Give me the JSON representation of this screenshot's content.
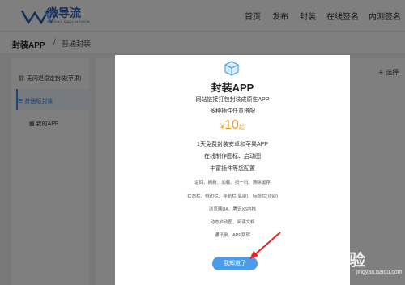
{
  "header": {
    "logo_text": "微导流",
    "logo_sub": "WEIDAO DAOLIUSHOW",
    "nav": [
      "首页",
      "发布",
      "封装",
      "在线签名",
      "内测签名"
    ]
  },
  "breadcrumb": {
    "title": "封装APP",
    "sep": "/",
    "current": "普通封装"
  },
  "sidebar": {
    "items": [
      {
        "label": "无闪退稳定封装(苹果)"
      },
      {
        "label": "普通版封装"
      },
      {
        "label": "我的APP"
      }
    ]
  },
  "main": {
    "select_label": "选择"
  },
  "modal": {
    "icon": "cube-icon",
    "title": "封装APP",
    "line1": "网站链接打包封装成原生APP",
    "line2": "多种插件任意搭配",
    "price_symbol": "¥",
    "price_value": "10",
    "price_suffix": "起",
    "line3": "1天免费封装安卓和苹果APP",
    "line4": "在线制作图标、启动图",
    "line5": "丰富插件等您配置",
    "features": [
      "返回、刷新、加载、扫一扫、清除缓存",
      "状态栏、侧边栏、导航栏(底部)、标题栏(顶部)",
      "浏览器UA、腾讯X5内核",
      "动态启动图、阅读文档",
      "通讯录、APP跳转"
    ],
    "button": "我知道了"
  },
  "watermark": {
    "text": "Bai经验",
    "sub": "jingyan.baidu.com"
  },
  "colors": {
    "accent": "#4a9be8",
    "price": "#f0a020",
    "arrow": "#e02424",
    "brand": "#2d5fb4"
  }
}
